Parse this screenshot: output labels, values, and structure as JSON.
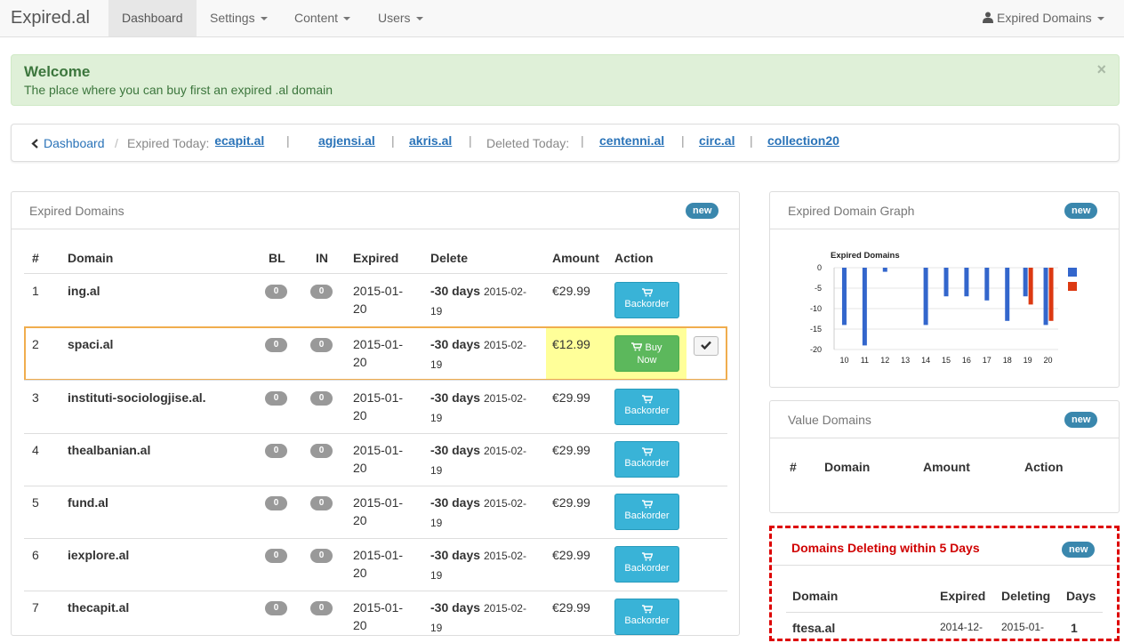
{
  "navbar": {
    "brand": "Expired.al",
    "items": [
      {
        "label": "Dashboard"
      },
      {
        "label": "Settings"
      },
      {
        "label": "Content"
      },
      {
        "label": "Users"
      }
    ],
    "user": "Expired Domains"
  },
  "alert": {
    "title": "Welcome",
    "text": "The place where you can buy first an expired .al domain",
    "close": "×"
  },
  "breadcrumb": {
    "home": "Dashboard",
    "separator": "/",
    "expired_label": "Expired Today:",
    "expired_today": [
      "thecapit.al",
      "agjensi.al",
      "akris.al"
    ],
    "deleted_label": "Deleted Today:",
    "deleted_today": [
      "centenni.al",
      "circ.al",
      "collection20"
    ]
  },
  "expired_panel": {
    "title": "Expired Domains",
    "badge": "new",
    "columns": [
      "#",
      "Domain",
      "BL",
      "IN",
      "Expired",
      "Delete",
      "Amount",
      "Action"
    ],
    "rows": [
      {
        "num": "1",
        "domain": "ing.al",
        "bl": "0",
        "in": "0",
        "exp1": "2015-01-",
        "exp2": "20",
        "del_days": "-30 days",
        "del_date1": "2015-02-",
        "del_date2": "19",
        "amount": "€29.99",
        "action1": "",
        "action2": "Backorder"
      },
      {
        "num": "2",
        "domain": "spaci.al",
        "bl": "0",
        "in": "0",
        "exp1": "2015-01-",
        "exp2": "20",
        "del_days": "-30 days",
        "del_date1": "2015-02-",
        "del_date2": "19",
        "amount": "€12.99",
        "action1": "Buy",
        "action2": "Now"
      },
      {
        "num": "3",
        "domain": "instituti-sociologjise.al.",
        "bl": "0",
        "in": "0",
        "exp1": "2015-01-",
        "exp2": "20",
        "del_days": "-30 days",
        "del_date1": "2015-02-",
        "del_date2": "19",
        "amount": "€29.99",
        "action1": "",
        "action2": "Backorder"
      },
      {
        "num": "4",
        "domain": "thealbanian.al",
        "bl": "0",
        "in": "0",
        "exp1": "2015-01-",
        "exp2": "20",
        "del_days": "-30 days",
        "del_date1": "2015-02-",
        "del_date2": "19",
        "amount": "€29.99",
        "action1": "",
        "action2": "Backorder"
      },
      {
        "num": "5",
        "domain": "fund.al",
        "bl": "0",
        "in": "0",
        "exp1": "2015-01-",
        "exp2": "20",
        "del_days": "-30 days",
        "del_date1": "2015-02-",
        "del_date2": "19",
        "amount": "€29.99",
        "action1": "",
        "action2": "Backorder"
      },
      {
        "num": "6",
        "domain": "iexplore.al",
        "bl": "0",
        "in": "0",
        "exp1": "2015-01-",
        "exp2": "20",
        "del_days": "-30 days",
        "del_date1": "2015-02-",
        "del_date2": "19",
        "amount": "€29.99",
        "action1": "",
        "action2": "Backorder"
      },
      {
        "num": "7",
        "domain": "thecapit.al",
        "bl": "0",
        "in": "0",
        "exp1": "2015-01-",
        "exp2": "20",
        "del_days": "-30 days",
        "del_date1": "2015-02-",
        "del_date2": "19",
        "amount": "€29.99",
        "action1": "",
        "action2": "Backorder"
      }
    ]
  },
  "graph_panel": {
    "title": "Expired Domain Graph",
    "badge": "new"
  },
  "chart_data": {
    "type": "bar",
    "title": "Expired Domains",
    "categories": [
      "10",
      "11",
      "12",
      "13",
      "14",
      "15",
      "16",
      "17",
      "18",
      "19",
      "20"
    ],
    "ylim": [
      -20,
      0
    ],
    "yticks": [
      "0",
      "-5",
      "-10",
      "-15",
      "-20"
    ],
    "series": [
      {
        "color": "#3366cc",
        "values": [
          -14,
          -19,
          -1,
          0,
          -14,
          -7,
          -7,
          -8,
          -13,
          -7,
          -14
        ]
      },
      {
        "color": "#dc3912",
        "values": [
          0,
          0,
          0,
          0,
          0,
          0,
          0,
          0,
          0,
          -9,
          -13
        ]
      }
    ],
    "legend_position": "right"
  },
  "value_panel": {
    "title": "Value Domains",
    "badge": "new",
    "columns": [
      "#",
      "Domain",
      "Amount",
      "Action"
    ]
  },
  "deleting_panel": {
    "title": "Domains Deleting within 5 Days",
    "badge": "new",
    "columns": [
      "Domain",
      "Expired",
      "Deleting",
      "Days"
    ],
    "first_row": {
      "domain": "ftesa.al",
      "expired": "2014-12-",
      "deleting": "2015-01-",
      "days": "1"
    }
  }
}
